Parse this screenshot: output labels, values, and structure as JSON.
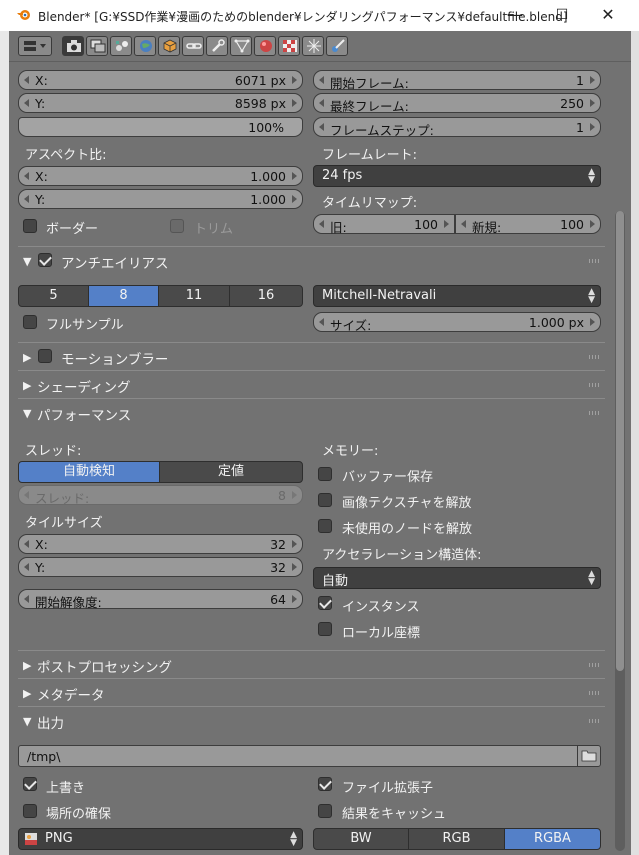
{
  "window": {
    "title": "Blender* [G:¥SSD作業¥漫画のためのblender¥レンダリングパフォーマンス¥defaultfile.blend]",
    "minimize": "—",
    "maximize": "☐",
    "close": "✕"
  },
  "dimensions": {
    "x_label": "X:",
    "x_value": "6071 px",
    "y_label": "Y:",
    "y_value": "8598 px",
    "percent": "100%",
    "aspect_label": "アスペクト比:",
    "ax_label": "X:",
    "ax_value": "1.000",
    "ay_label": "Y:",
    "ay_value": "1.000",
    "border_label": "ボーダー",
    "crop_label": "トリム"
  },
  "frame_range": {
    "start_label": "開始フレーム:",
    "start_value": "1",
    "end_label": "最終フレーム:",
    "end_value": "250",
    "step_label": "フレームステップ:",
    "step_value": "1",
    "fps_label": "フレームレート:",
    "fps_value": "24 fps",
    "remap_label": "タイムリマップ:",
    "old_label": "旧:",
    "old_value": "100",
    "new_label": "新規:",
    "new_value": "100"
  },
  "antialiasing": {
    "title": "アンチエイリアス",
    "samples": [
      "5",
      "8",
      "11",
      "16"
    ],
    "selected_sample": "8",
    "filter": "Mitchell-Netravali",
    "full_sample_label": "フルサンプル",
    "size_label": "サイズ:",
    "size_value": "1.000 px"
  },
  "sections": {
    "motion_blur": "モーションブラー",
    "shading": "シェーディング",
    "performance": "パフォーマンス",
    "post_processing": "ポストプロセッシング",
    "metadata": "メタデータ",
    "output": "出力"
  },
  "performance": {
    "threads_label": "スレッド:",
    "thread_modes": [
      "自動検知",
      "定値"
    ],
    "thread_field_label": "スレッド:",
    "thread_field_value": "8",
    "tiles_label": "タイルサイズ",
    "tx_label": "X:",
    "tx_value": "32",
    "ty_label": "Y:",
    "ty_value": "32",
    "start_res_label": "開始解像度:",
    "start_res_value": "64",
    "memory_label": "メモリー:",
    "save_buffers": "バッファー保存",
    "free_textures": "画像テクスチャを解放",
    "free_unused_nodes": "未使用のノードを解放",
    "accel_label": "アクセラレーション構造体:",
    "accel_value": "自動",
    "instances": "インスタンス",
    "local_coords": "ローカル座標"
  },
  "output": {
    "path": "/tmp\\",
    "overwrite": "上書き",
    "file_extensions": "ファイル拡張子",
    "placeholders": "場所の確保",
    "cache_result": "結果をキャッシュ",
    "format": "PNG",
    "color_modes": [
      "BW",
      "RGB",
      "RGBA"
    ]
  },
  "colors": {
    "panel_bg": "#727272",
    "selected_blue": "#5480c8",
    "field_bg": "#999999"
  }
}
